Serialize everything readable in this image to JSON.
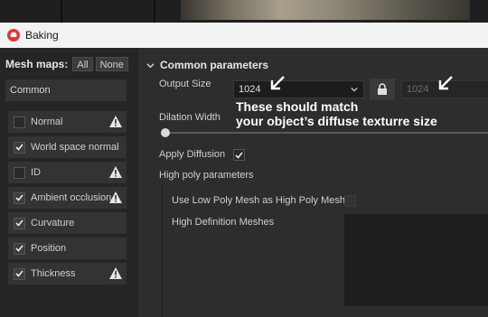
{
  "window": {
    "title": "Baking"
  },
  "mesh_maps": {
    "label": "Mesh maps:",
    "all_label": "All",
    "none_label": "None",
    "group_value": "Common",
    "items": [
      {
        "label": "Normal",
        "checked": false,
        "warning": true
      },
      {
        "label": "World space normal",
        "checked": true,
        "warning": false
      },
      {
        "label": "ID",
        "checked": false,
        "warning": true
      },
      {
        "label": "Ambient occlusion",
        "checked": true,
        "warning": true
      },
      {
        "label": "Curvature",
        "checked": true,
        "warning": false
      },
      {
        "label": "Position",
        "checked": true,
        "warning": false
      },
      {
        "label": "Thickness",
        "checked": true,
        "warning": true
      }
    ]
  },
  "params": {
    "section_title": "Common parameters",
    "output_size_label": "Output Size",
    "output_size_value": "1024",
    "output_size_linked_value": "1024",
    "dilation_label": "Dilation Width",
    "apply_diffusion_label": "Apply Diffusion",
    "apply_diffusion_checked": true,
    "high_poly_label": "High poly parameters",
    "use_low_poly_label": "Use Low Poly Mesh as High Poly Mesh",
    "use_low_poly_checked": false,
    "hd_meshes_label": "High Definition Meshes"
  },
  "annotation": {
    "line1": "These should match",
    "line2": "your object’s diffuse texturre size"
  },
  "colors": {
    "warning": "#e6e6e6",
    "accent_logo": "#d93a3a"
  }
}
